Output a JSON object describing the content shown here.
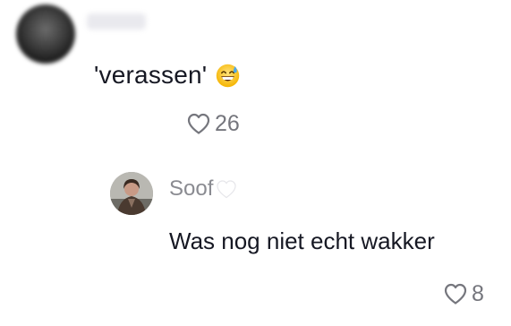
{
  "comment": {
    "username": "",
    "text": "'verassen'",
    "emoji": "grinning-face-with-sweat-icon",
    "likes": "26"
  },
  "reply": {
    "username": "Soof",
    "username_suffix_icon": "white-heart-icon",
    "text": "Was nog niet echt wakker",
    "likes": "8"
  },
  "colors": {
    "text_primary": "#161823",
    "text_secondary": "#75767d",
    "username": "#8a8b91"
  }
}
